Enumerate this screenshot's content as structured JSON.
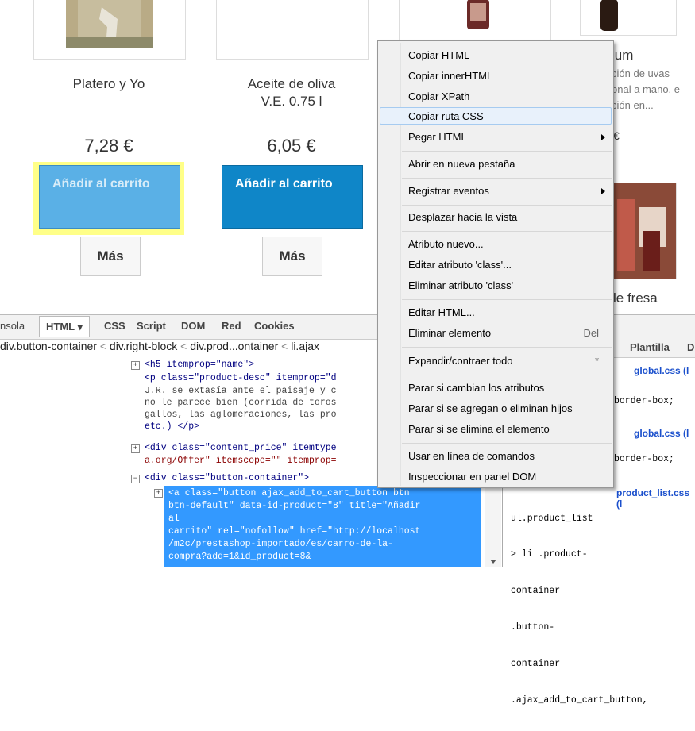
{
  "products": [
    {
      "name_line1": "Platero y Yo",
      "name_line2": "",
      "price": "7,28 €",
      "cart": "Añadir al carrito",
      "more": "Más"
    },
    {
      "name_line1": "Aceite de oliva",
      "name_line2": "V.E. 0.75 l",
      "price": "6,05 €",
      "cart": "Añadir al carrito",
      "more": "Más"
    }
  ],
  "partial_product": {
    "title_fragment": "ium",
    "desc_lines": [
      "ción de uvas",
      "onal a mano, e",
      "ción en..."
    ],
    "price_fragment": "€",
    "bottom_name_fragment": "le fresa"
  },
  "firebug": {
    "tabs": [
      "nsola",
      "HTML ▾",
      "CSS",
      "Script",
      "DOM",
      "Red",
      "Cookies"
    ],
    "breadcrumbs": [
      "div.button-container",
      "div.right-block",
      "div.prod...ontainer",
      "li.ajax"
    ],
    "crumb_sep": "<",
    "right_tabs": [
      "Plantilla",
      "D"
    ],
    "code_lines": [
      "<h5 itemprop=\"name\">",
      "<p class=\"product-desc\" itemprop=\"d",
      "J.R. se extasía ante el paisaje y c",
      "no le parece bien (corrida de toros",
      "gallos, las aglomeraciones, las pro",
      "etc.) </p>",
      "<div class=\"content_price\" itemtype",
      "a.org/Offer\" itemscope=\"\" itemprop=",
      "<div class=\"button-container\">"
    ],
    "selected_lines": [
      "<a class=\"button ajax_add_to_cart_button btn",
      "btn-default\" data-id-product=\"8\" title=\"Añadir",
      "al",
      "carrito\" rel=\"nofollow\" href=\"http://localhost",
      "/m2c/prestashop-importado/es/carro-de-la-",
      "compra?add=1&id_product=8&"
    ],
    "css_panel": {
      "file1": "global.css (l",
      "rule1": "border-box;",
      "file2": "global.css (l",
      "rule2": "border-box;",
      "file3": "product_list.css (l",
      "selector_lines": [
        "ul.product_list",
        "> li .product-",
        "container",
        ".button-",
        "container",
        ".ajax_add_to_cart_button,"
      ]
    }
  },
  "context_menu": {
    "items": [
      {
        "label": "Copiar HTML"
      },
      {
        "label": "Copiar innerHTML"
      },
      {
        "label": "Copiar XPath"
      },
      {
        "label": "Copiar ruta CSS"
      },
      {
        "label": "Pegar HTML"
      },
      {
        "label": "Abrir en nueva pestaña"
      },
      {
        "label": "Registrar eventos"
      },
      {
        "label": "Desplazar hacia la vista"
      },
      {
        "label": "Atributo nuevo..."
      },
      {
        "label": "Editar atributo 'class'..."
      },
      {
        "label": "Eliminar atributo 'class'"
      },
      {
        "label": "Editar HTML..."
      },
      {
        "label": "Eliminar elemento",
        "shortcut": "Del"
      },
      {
        "label": "Expandir/contraer todo",
        "shortcut": "*"
      },
      {
        "label": "Parar si cambian los atributos"
      },
      {
        "label": "Parar si se agregan o eliminan hijos"
      },
      {
        "label": "Parar si se elimina el elemento"
      },
      {
        "label": "Usar en línea de comandos"
      },
      {
        "label": "Inspeccionar en panel DOM"
      }
    ]
  },
  "colors": {
    "cart_button": "#0f86c8",
    "cart_button_inspected": "#5ab0e6",
    "inspect_highlight": "#ffff88",
    "selection": "#3399ff",
    "menu_hover": "#e8f1fb"
  }
}
